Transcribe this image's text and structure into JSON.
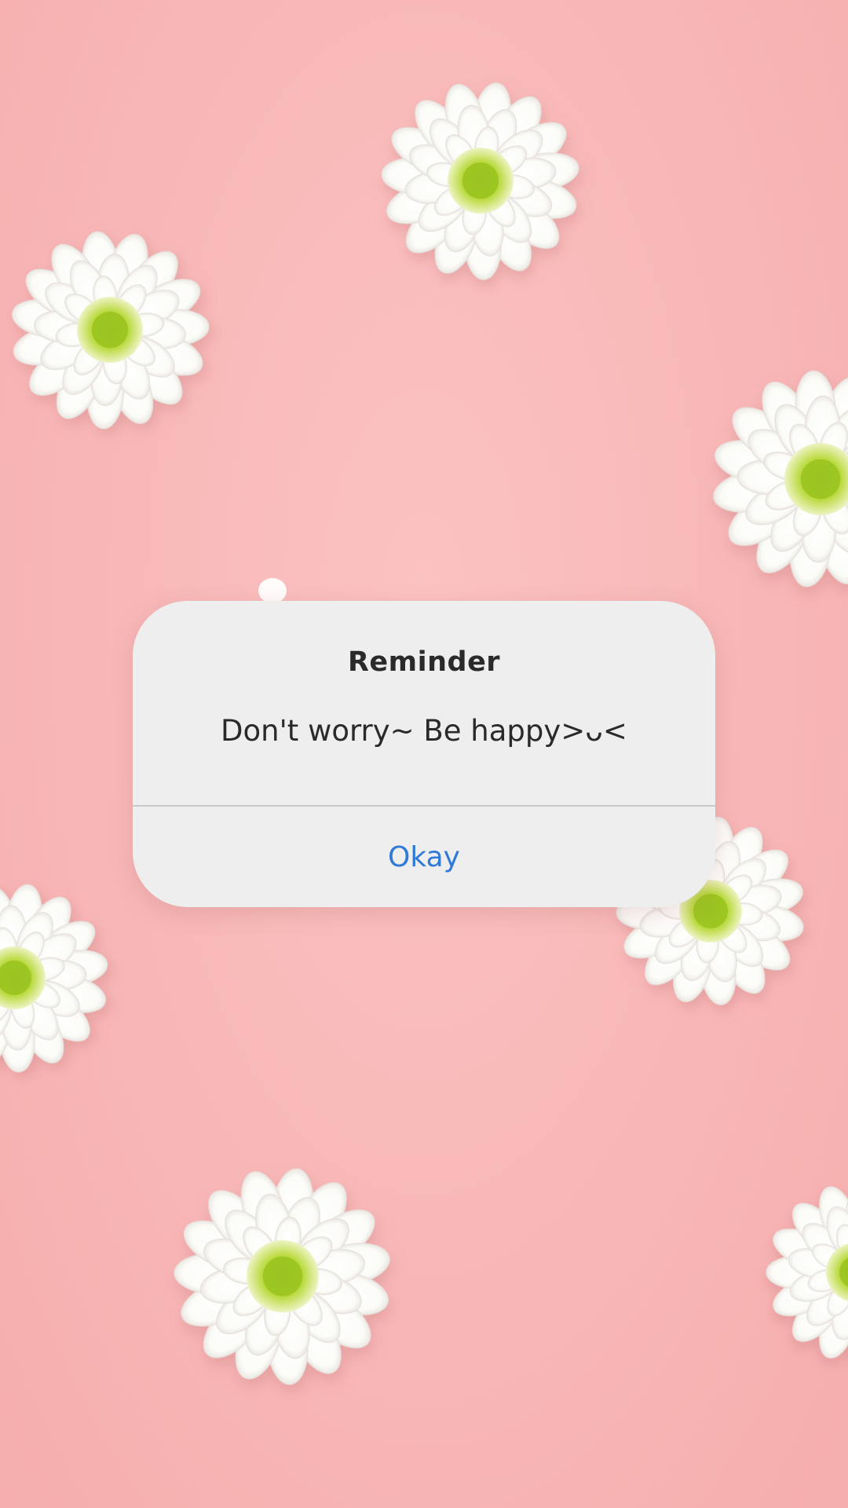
{
  "colors": {
    "background": "#f9b9b9",
    "dialog_background": "#eeeeee",
    "title_text": "#2a2a2a",
    "action_blue": "#2f7ad8",
    "flower_petal": "#ffffff",
    "flower_center": "#9cc82a"
  },
  "wallpaper": {
    "subject": "white chrysanthemum flowers on pink background"
  },
  "dialog": {
    "title": "Reminder",
    "message": "Don't worry~ Be happy>ᴗ<",
    "button_label": "Okay"
  }
}
